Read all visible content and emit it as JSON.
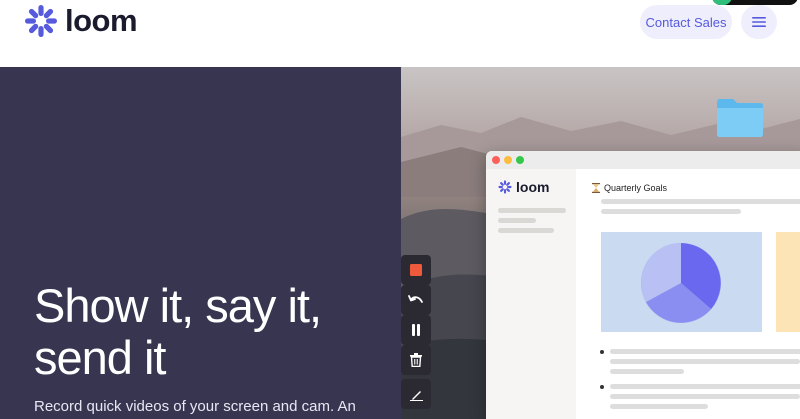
{
  "header": {
    "logo_text": "loom",
    "contact_label": "Contact Sales",
    "menu_icon": "hamburger-icon"
  },
  "hero": {
    "headline_line1": "Show it, say it,",
    "headline_line2": "send it",
    "subcopy": "Record quick videos of your screen and cam. An"
  },
  "window": {
    "logo_text": "loom",
    "doc_title": "Quarterly Goals",
    "doc_icon": "hourglass-icon"
  },
  "recorder": {
    "tools": [
      "stop-record-icon",
      "undo-icon",
      "pause-icon",
      "trash-icon",
      "pen-icon"
    ]
  },
  "colors": {
    "brand": "#565adc",
    "hero_bg": "#37354f",
    "record": "#f05a3c"
  }
}
